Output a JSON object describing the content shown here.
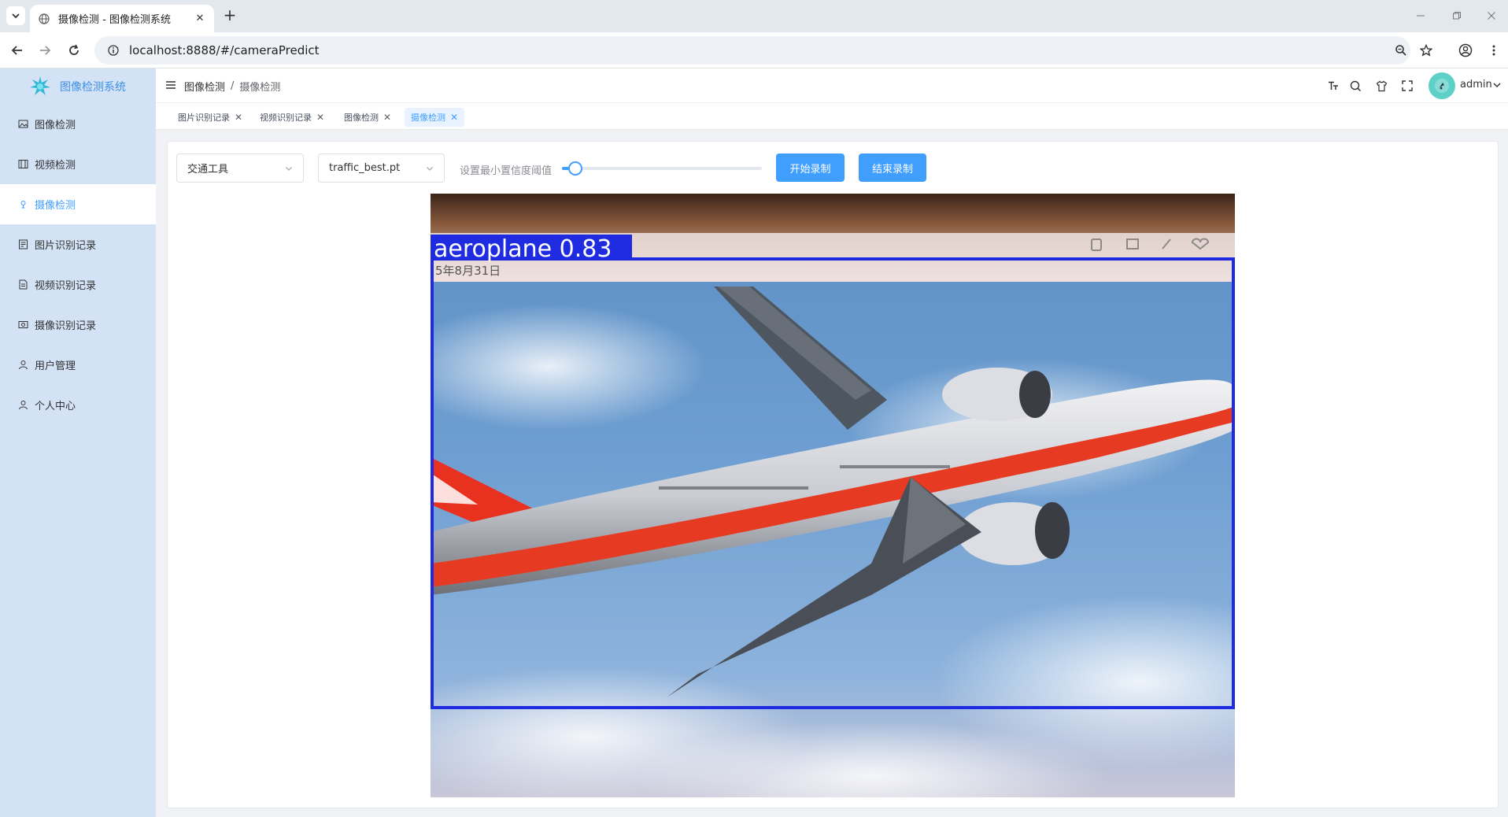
{
  "browser": {
    "tab_title": "摄像检测 - 图像检测系统",
    "url": "localhost:8888/#/cameraPredict"
  },
  "sidebar": {
    "brand": "图像检测系统",
    "items": [
      {
        "label": "图像检测",
        "icon": "image-icon"
      },
      {
        "label": "视频检测",
        "icon": "video-icon"
      },
      {
        "label": "摄像检测",
        "icon": "camera-icon",
        "active": true
      },
      {
        "label": "图片识别记录",
        "icon": "image-record-icon"
      },
      {
        "label": "视频识别记录",
        "icon": "video-record-icon"
      },
      {
        "label": "摄像识别记录",
        "icon": "camera-record-icon"
      },
      {
        "label": "用户管理",
        "icon": "user-icon"
      },
      {
        "label": "个人中心",
        "icon": "person-icon"
      }
    ]
  },
  "header": {
    "breadcrumb": [
      "图像检测",
      "摄像检测"
    ],
    "username": "admin"
  },
  "tags": [
    {
      "label": "图片识别记录"
    },
    {
      "label": "视频识别记录"
    },
    {
      "label": "图像检测"
    },
    {
      "label": "摄像检测",
      "active": true
    }
  ],
  "controls": {
    "category_select": "交通工具",
    "model_select": "traffic_best.pt",
    "threshold_label": "设置最小置信度阈值",
    "threshold_value": 0.05,
    "start_button": "开始录制",
    "stop_button": "结束录制"
  },
  "detection": {
    "label": "aeroplane 0.83",
    "frame_date_text": "5年8月31日"
  },
  "colors": {
    "accent": "#409eff",
    "sidebar_bg": "#d3e3f5",
    "bbox": "#1f2be0"
  }
}
